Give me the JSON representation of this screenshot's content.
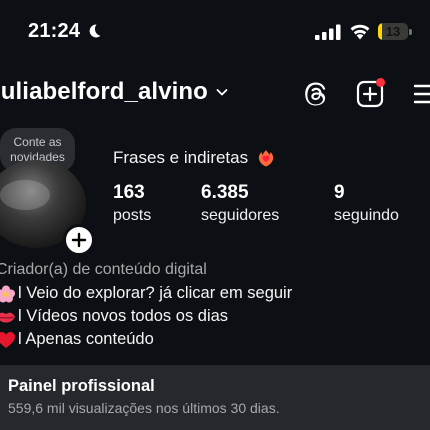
{
  "status_bar": {
    "time": "21:24",
    "battery_level": "13",
    "battery_fraction": 0.13,
    "icons": [
      "moon-icon",
      "cellular-signal-icon",
      "wifi-icon",
      "battery-icon"
    ]
  },
  "header": {
    "username": "juliabelford_alvino",
    "icons": [
      "chevron-down-icon",
      "threads-icon",
      "create-icon",
      "menu-icon"
    ],
    "notification_color": "#ff3040"
  },
  "note": {
    "text_line1": "Conte as",
    "text_line2": "novidades"
  },
  "profile": {
    "bio_title": "Frases e indiretas",
    "stats": [
      {
        "value": "163",
        "label": "posts"
      },
      {
        "value": "6.385",
        "label": "seguidores"
      },
      {
        "value": "9",
        "label": "seguindo"
      }
    ],
    "category": "Criador(a) de conteúdo digital",
    "bio_lines": [
      {
        "icon": "flower-icon",
        "text": "l Veio do explorar? já clicar em seguir"
      },
      {
        "icon": "lips-icon",
        "text": "l Vídeos novos todos os dias"
      },
      {
        "icon": "heart-icon",
        "text": "l Apenas conteúdo"
      }
    ]
  },
  "professional_dashboard": {
    "title": "Painel profissional",
    "subtitle": "559,6 mil visualizações nos últimos 30 dias."
  },
  "colors": {
    "background": "#0c1014",
    "panel": "#25292e",
    "battery": "#ffd60a",
    "muted_text": "#a8a8a8"
  }
}
